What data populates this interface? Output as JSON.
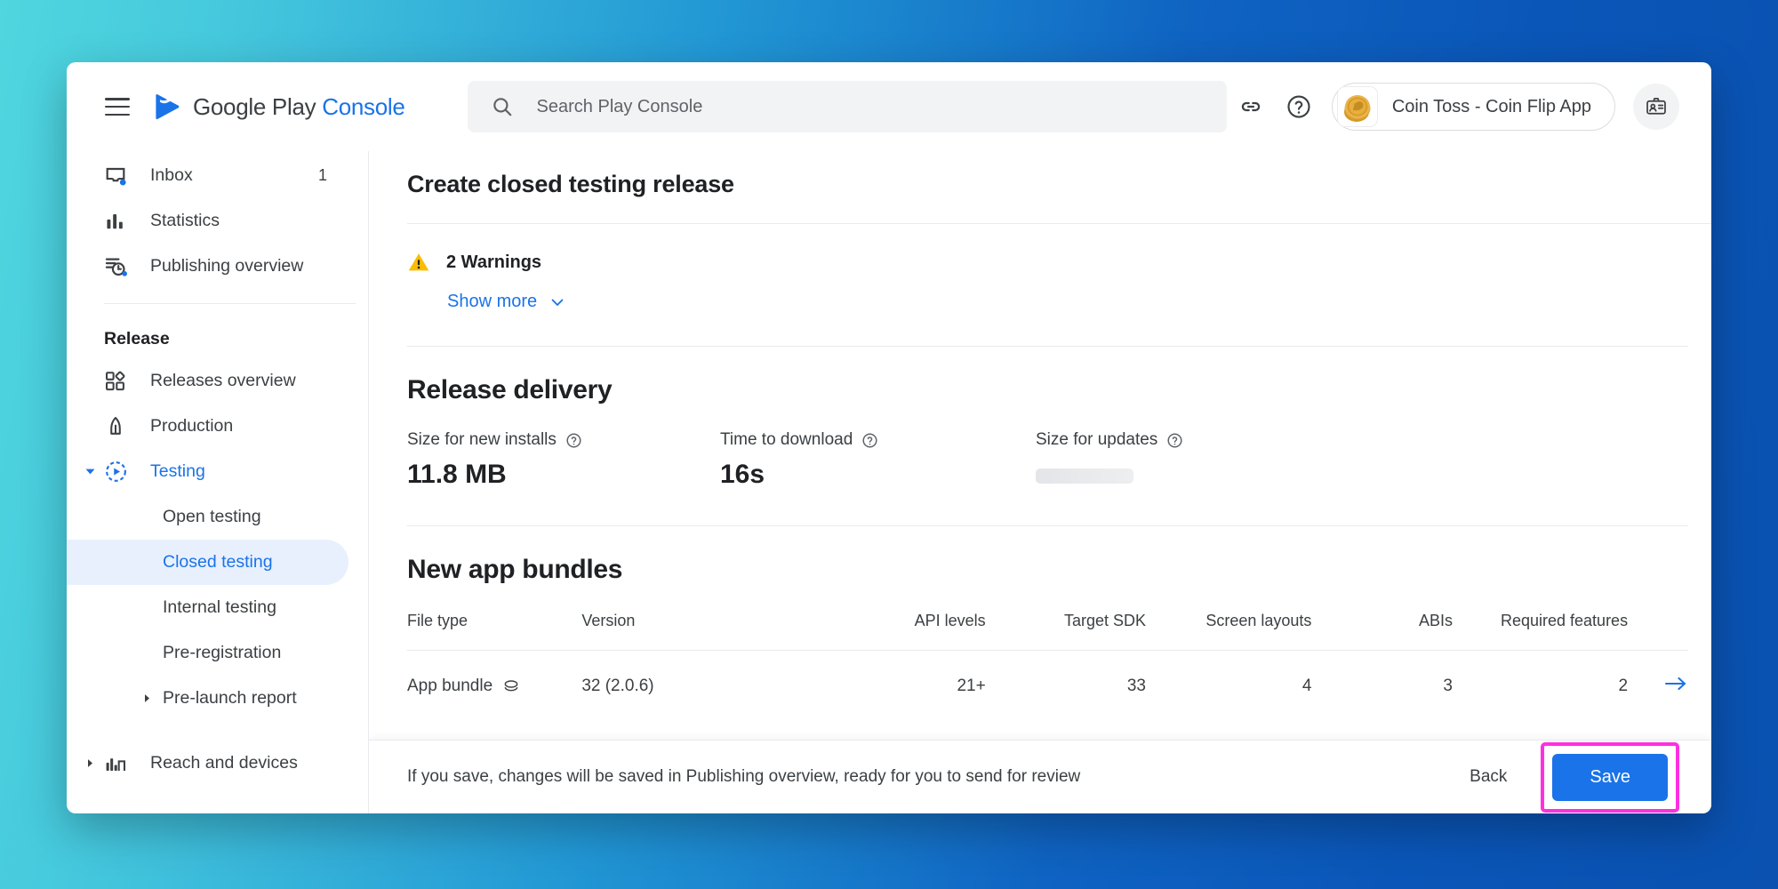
{
  "app": {
    "brand_google_play": "Google Play",
    "brand_console": "Console"
  },
  "search": {
    "placeholder": "Search Play Console",
    "value": ""
  },
  "topbar": {
    "app_name": "Coin Toss - Coin Flip App",
    "link_icon": "link-icon",
    "help_icon": "help-circle-icon",
    "account_icon": "account-badge-icon",
    "menu_icon": "hamburger-menu-icon"
  },
  "sidebar": {
    "primary": [
      {
        "label": "Inbox",
        "badge": "1",
        "icon": "inbox-icon"
      },
      {
        "label": "Statistics",
        "badge": "",
        "icon": "statistics-icon"
      },
      {
        "label": "Publishing overview",
        "badge": "",
        "icon": "publishing-overview-icon"
      }
    ],
    "section_title": "Release",
    "release_items": [
      {
        "label": "Releases overview",
        "icon": "releases-overview-icon"
      },
      {
        "label": "Production",
        "icon": "production-rocket-icon"
      },
      {
        "label": "Testing",
        "icon": "testing-play-icon",
        "expanded": true,
        "active_parent": true
      }
    ],
    "testing_children": [
      {
        "label": "Open testing",
        "active": false
      },
      {
        "label": "Closed testing",
        "active": true
      },
      {
        "label": "Internal testing",
        "active": false
      },
      {
        "label": "Pre-registration",
        "active": false
      },
      {
        "label": "Pre-launch report",
        "active": false,
        "expandable": true
      }
    ],
    "bottom_items": [
      {
        "label": "Reach and devices",
        "icon": "reach-devices-icon",
        "expandable": true
      }
    ]
  },
  "main": {
    "page_title": "Create closed testing release",
    "warnings": {
      "count_label": "2 Warnings",
      "show_more_label": "Show more",
      "icon": "warning-triangle-icon"
    },
    "release_delivery": {
      "heading": "Release delivery",
      "metrics": [
        {
          "label": "Size for new installs",
          "value": "11.8 MB",
          "loading": false
        },
        {
          "label": "Time to download",
          "value": "16s",
          "loading": false
        },
        {
          "label": "Size for updates",
          "value": "",
          "loading": true
        }
      ]
    },
    "bundles": {
      "heading": "New app bundles",
      "columns": [
        "File type",
        "Version",
        "API levels",
        "Target SDK",
        "Screen layouts",
        "ABIs",
        "Required features"
      ],
      "rows": [
        {
          "file_type": "App bundle",
          "version": "32 (2.0.6)",
          "api_levels": "21+",
          "target_sdk": "33",
          "screen_layouts": "4",
          "abis": "3",
          "required_features": "2"
        }
      ]
    }
  },
  "bottombar": {
    "hint": "If you save, changes will be saved in Publishing overview, ready for you to send for review",
    "back_label": "Back",
    "save_label": "Save"
  },
  "colors": {
    "accent_blue": "#1a73e8",
    "warning_yellow": "#fbbc04",
    "active_bg": "#e8f0fe",
    "highlight_magenta": "#ff2fe0",
    "bg_gradient_left": "#4fd6de",
    "bg_gradient_right": "#0a51b0"
  }
}
